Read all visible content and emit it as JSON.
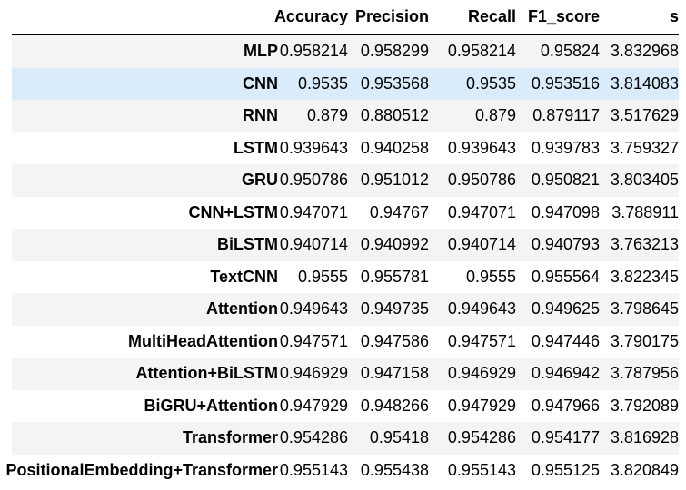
{
  "chart_data": {
    "type": "table",
    "columns": [
      "Accuracy",
      "Precision",
      "Recall",
      "F1_score",
      "s"
    ],
    "rows": [
      {
        "name": "MLP",
        "values": [
          "0.958214",
          "0.958299",
          "0.958214",
          "0.95824",
          "3.832968"
        ]
      },
      {
        "name": "CNN",
        "values": [
          "0.9535",
          "0.953568",
          "0.9535",
          "0.953516",
          "3.814083"
        ]
      },
      {
        "name": "RNN",
        "values": [
          "0.879",
          "0.880512",
          "0.879",
          "0.879117",
          "3.517629"
        ]
      },
      {
        "name": "LSTM",
        "values": [
          "0.939643",
          "0.940258",
          "0.939643",
          "0.939783",
          "3.759327"
        ]
      },
      {
        "name": "GRU",
        "values": [
          "0.950786",
          "0.951012",
          "0.950786",
          "0.950821",
          "3.803405"
        ]
      },
      {
        "name": "CNN+LSTM",
        "values": [
          "0.947071",
          "0.94767",
          "0.947071",
          "0.947098",
          "3.788911"
        ]
      },
      {
        "name": "BiLSTM",
        "values": [
          "0.940714",
          "0.940992",
          "0.940714",
          "0.940793",
          "3.763213"
        ]
      },
      {
        "name": "TextCNN",
        "values": [
          "0.9555",
          "0.955781",
          "0.9555",
          "0.955564",
          "3.822345"
        ]
      },
      {
        "name": "Attention",
        "values": [
          "0.949643",
          "0.949735",
          "0.949643",
          "0.949625",
          "3.798645"
        ]
      },
      {
        "name": "MultiHeadAttention",
        "values": [
          "0.947571",
          "0.947586",
          "0.947571",
          "0.947446",
          "3.790175"
        ]
      },
      {
        "name": "Attention+BiLSTM",
        "values": [
          "0.946929",
          "0.947158",
          "0.946929",
          "0.946942",
          "3.787956"
        ]
      },
      {
        "name": "BiGRU+Attention",
        "values": [
          "0.947929",
          "0.948266",
          "0.947929",
          "0.947966",
          "3.792089"
        ]
      },
      {
        "name": "Transformer",
        "values": [
          "0.954286",
          "0.95418",
          "0.954286",
          "0.954177",
          "3.816928"
        ]
      },
      {
        "name": "PositionalEmbedding+Transformer",
        "values": [
          "0.955143",
          "0.955438",
          "0.955143",
          "0.955125",
          "3.820849"
        ]
      }
    ],
    "highlighted_row": "CNN",
    "highlighted_row_index": 1,
    "title": "",
    "layout": {
      "grid": false,
      "striped": true,
      "header_rule": true
    }
  },
  "style": {
    "stripe_color": "#f4f4f4",
    "highlight_color": "#d9ecfb",
    "header_border_color": "#000000",
    "text_color": "#000000"
  }
}
